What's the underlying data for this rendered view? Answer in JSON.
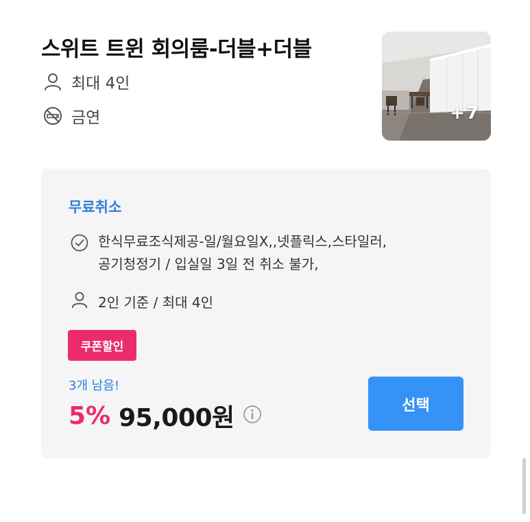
{
  "room": {
    "title": "스위트 트윈 회의룸-더블+더블",
    "capacity": "최대 4인",
    "smoking": "금연",
    "photo_more": "+7"
  },
  "offer": {
    "cancel_policy": "무료취소",
    "benefits_line1": "한식무료조식제공-일/월요일X,,넷플릭스,스타일러,",
    "benefits_line2": "공기청정기 / 입실일 3일 전 취소 불가,",
    "occupancy": "2인 기준 / 최대 4인",
    "coupon_badge": "쿠폰할인",
    "stock": "3개 남음!",
    "discount": "5%",
    "price": "95,000원",
    "select_label": "선택"
  },
  "colors": {
    "accent_blue": "#3592f7",
    "link_blue": "#2f80d6",
    "coupon_pink": "#ec2c6a",
    "card_bg": "#f5f5f7"
  },
  "icons": {
    "capacity": "person-icon",
    "smoking": "no-smoking-icon",
    "benefit": "check-circle-icon",
    "occupancy": "person-icon",
    "price_info": "info-icon"
  }
}
